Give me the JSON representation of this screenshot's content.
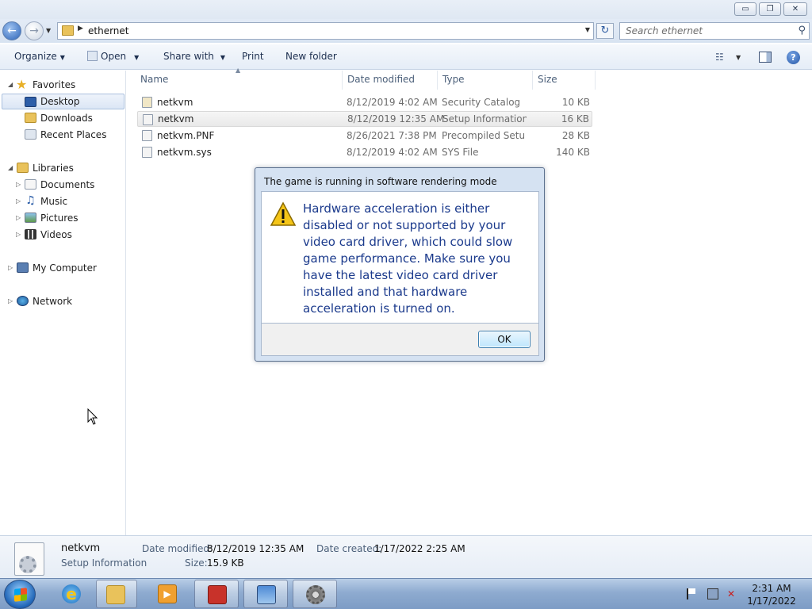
{
  "window": {
    "min_glyph": "▭",
    "max_glyph": "❐",
    "close_glyph": "✕"
  },
  "address": {
    "path": "ethernet",
    "search_placeholder": "Search ethernet"
  },
  "toolbar": {
    "organize": "Organize",
    "open": "Open",
    "share_with": "Share with",
    "print": "Print",
    "new_folder": "New folder"
  },
  "nav": {
    "favorites": "Favorites",
    "desktop": "Desktop",
    "downloads": "Downloads",
    "recent_places": "Recent Places",
    "libraries": "Libraries",
    "documents": "Documents",
    "music": "Music",
    "pictures": "Pictures",
    "videos": "Videos",
    "my_computer": "My Computer",
    "network": "Network"
  },
  "columns": {
    "name": "Name",
    "date_modified": "Date modified",
    "type": "Type",
    "size": "Size"
  },
  "files": [
    {
      "name": "netkvm",
      "date": "8/12/2019 4:02 AM",
      "type": "Security Catalog",
      "size": "10 KB",
      "icon": "security-catalog-icon"
    },
    {
      "name": "netkvm",
      "date": "8/12/2019 12:35 AM",
      "type": "Setup Information",
      "size": "16 KB",
      "icon": "setup-information-icon"
    },
    {
      "name": "netkvm.PNF",
      "date": "8/26/2021 7:38 PM",
      "type": "Precompiled Setu...",
      "size": "28 KB",
      "icon": "pnf-file-icon"
    },
    {
      "name": "netkvm.sys",
      "date": "8/12/2019 4:02 AM",
      "type": "SYS File",
      "size": "140 KB",
      "icon": "sys-file-icon"
    }
  ],
  "dialog": {
    "title": "The game is running in software rendering mode",
    "message": "Hardware acceleration is either disabled or not supported by your video card driver, which could slow game performance. Make sure you have the latest video card driver installed and that hardware acceleration is turned on.",
    "ok": "OK",
    "icon": "warning-icon"
  },
  "details": {
    "name": "netkvm",
    "type": "Setup Information",
    "date_modified_label": "Date modified:",
    "date_modified": "8/12/2019 12:35 AM",
    "date_created_label": "Date created:",
    "date_created": "1/17/2022 2:25 AM",
    "size_label": "Size:",
    "size": "15.9 KB"
  },
  "taskbar": {
    "time": "2:31 AM",
    "date": "1/17/2022",
    "apps": [
      "internet-explorer-icon",
      "file-explorer-icon",
      "media-player-icon",
      "toolbox-icon",
      "control-panel-icon",
      "game-settings-icon"
    ]
  },
  "colors": {
    "dialog_text": "#1b3a8c",
    "taskbar": "#8eabd0",
    "selection": "#dbe6f5"
  }
}
